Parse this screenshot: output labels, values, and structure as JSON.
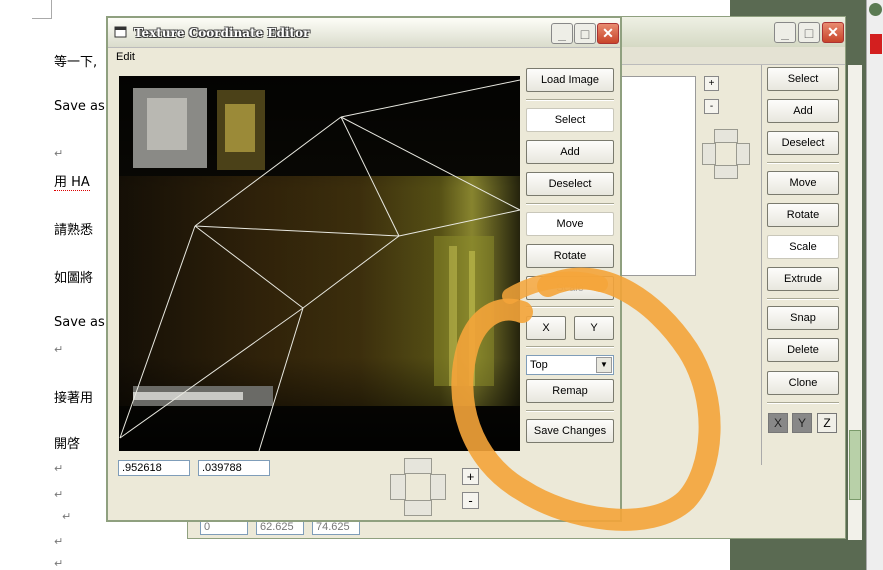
{
  "document": {
    "lines": [
      {
        "text": "等一下,"
      },
      {
        "text": "Save as"
      },
      {
        "text": ""
      },
      {
        "text": "用 HA"
      },
      {
        "text": "請熟悉"
      },
      {
        "text": "如圖將"
      },
      {
        "text": "Save as"
      },
      {
        "text": ""
      },
      {
        "text": "接著用"
      },
      {
        "text": "開啓"
      }
    ],
    "para_mark": "↵"
  },
  "back_window": {
    "buttons": {
      "select": "Select",
      "add": "Add",
      "deselect": "Deselect",
      "move": "Move",
      "rotate": "Rotate",
      "scale": "Scale",
      "extrude": "Extrude",
      "snap": "Snap",
      "delete": "Delete",
      "clone": "Clone"
    },
    "plus": "+",
    "minus": "-",
    "axes": [
      "X",
      "Y",
      "Z"
    ],
    "fields": [
      "0",
      "62.625",
      "74.625"
    ]
  },
  "texture_editor": {
    "title": "Texture Coordinate Editor",
    "menu": {
      "edit": "Edit"
    },
    "buttons": {
      "load_image": "Load Image",
      "select": "Select",
      "add": "Add",
      "deselect": "Deselect",
      "move": "Move",
      "rotate": "Rotate",
      "scale": "Scale",
      "x": "X",
      "y": "Y",
      "remap": "Remap",
      "save_changes": "Save Changes"
    },
    "projection": {
      "selected": "Top"
    },
    "coords": {
      "u": ".952618",
      "v": ".039788"
    },
    "zoom_in": "+",
    "zoom_out": "-",
    "highlight_color": "#f5a623"
  },
  "colors": {
    "title_close": "#c8442a",
    "annotation": "#f4a43a"
  }
}
